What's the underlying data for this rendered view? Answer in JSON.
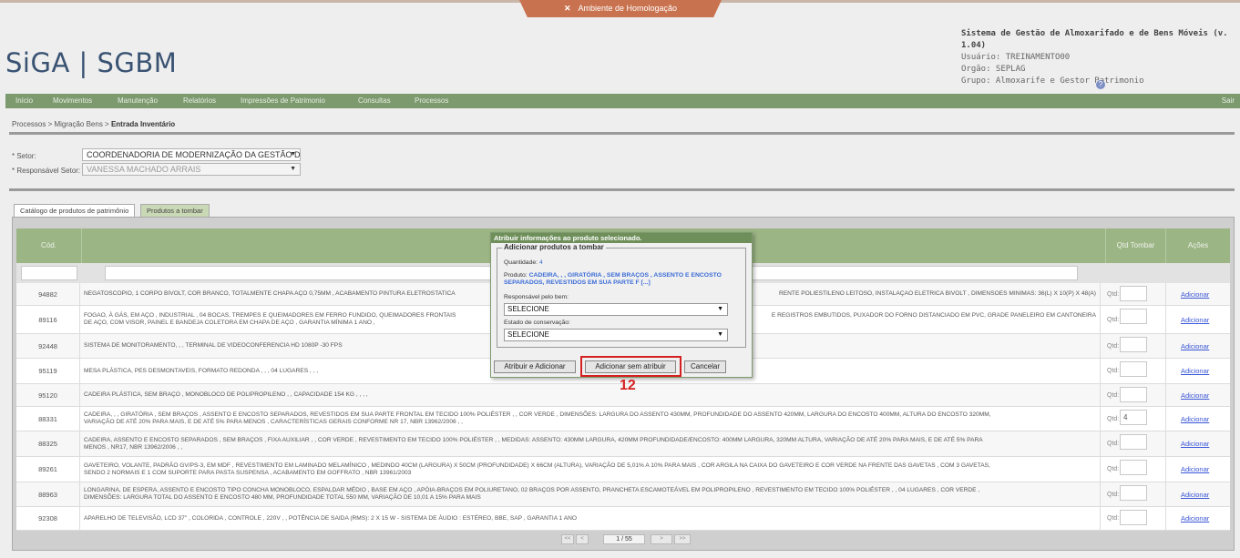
{
  "banner": {
    "label": "Ambiente de Homologação",
    "icon": "tools-icon"
  },
  "header": {
    "logo": "SiGA | SGBM",
    "system_title": "Sistema de Gestão de Almoxarifado e de Bens Móveis (v. 1.04)",
    "usuario": "Usuário: TREINAMENTO00",
    "orgao": "Orgão: SEPLAG",
    "grupo": "Grupo: Almoxarife e Gestor Patrimonio",
    "help_icon": "?"
  },
  "menu": {
    "items": [
      "Início",
      "Movimentos",
      "Manutenção",
      "Relatórios",
      "Impressões de Patrimonio",
      "Consultas",
      "Processos"
    ],
    "sair": "Sair"
  },
  "breadcrumb": {
    "path": "Processos  > Migração Bens  > ",
    "current": "Entrada Inventário"
  },
  "form": {
    "setor_label": "* Setor:",
    "setor_value": "COORDENADORIA DE MODERNIZAÇÃO DA GESTÃO DO",
    "responsavel_label": "* Responsável Setor:",
    "responsavel_value": "VANESSA MACHADO ARRAIS"
  },
  "tabs": [
    "Catálogo de produtos de patrimônio",
    "Produtos a tombar"
  ],
  "table": {
    "headers": {
      "cod": "Cód.",
      "qtd": "Qtd Tombar",
      "acoes": "Ações"
    },
    "qtd_label": "Qtd:",
    "action_label": "Adicionar",
    "rows": [
      {
        "cod": "94882",
        "desc": "NEGATOSCOPIO, 1 CORPO BIVOLT, COR BRANCO, TOTALMENTE CHAPA AÇO 0,75MM , ACABAMENTO PINTURA ELETROSTATICA",
        "desc_right": "RENTE POLIESTILENO LEITOSO, INSTALAÇAO ELETRICA BIVOLT , DIMENSOES MINIMAS: 36(L) X 10(P) X 48(A)",
        "qtd": ""
      },
      {
        "cod": "89116",
        "desc": "FOGAO, À GÁS, EM AÇO , INDUSTRIAL , 04 BOCAS, TREMPES E QUEIMADORES EM FERRO FUNDIDO, QUEIMADORES FRONTAIS",
        "desc2": "DE AÇO, COM VISOR, PAINEL E BANDEJA COLETORA EM CHAPA DE AÇO , GARANTIA MÍNIMA 1 ANO ,",
        "desc_right": "E REGISTROS EMBUTIDOS, PUXADOR DO FORNO DISTANCIADO EM PVC, GRADE PANELEIRO EM CANTONEIRA",
        "qtd": ""
      },
      {
        "cod": "92448",
        "desc": "SISTEMA DE MONITORAMENTO, , , TERMINAL DE VIDEOCONFERENCIA HD 1080P -30 FPS",
        "qtd": ""
      },
      {
        "cod": "95119",
        "desc": "MESA PLÁSTICA, PES DESMONTAVEIS, FORMATO REDONDA , , , 04 LUGARES , , ,",
        "qtd": ""
      },
      {
        "cod": "95120",
        "desc": "CADEIRA PLÁSTICA, SEM BRAÇO , MONOBLOCO DE POLIPROPILENO , , CAPACIDADE 154 KG , , , ,",
        "qtd": ""
      },
      {
        "cod": "88331",
        "desc": "CADEIRA, , , GIRATÓRIA , SEM BRAÇOS , ASSENTO E ENCOSTO SEPARADOS, REVESTIDOS EM SUA PARTE FRONTAL EM TECIDO 100% POLIÉSTER , , COR VERDE , DIMENSÕES: LARGURA DO ASSENTO 430MM, PROFUNDIDADE DO ASSENTO 420MM, LARGURA DO ENCOSTO 400MM, ALTURA DO ENCOSTO 320MM,",
        "desc2": "VARIAÇÃO DE ATÉ 20% PARA MAIS, E DE ATÉ 5% PARA MENOS , CARACTERÍSTICAS GERAIS CONFORME NR 17, NBR 13962/2006 , ,",
        "qtd": "4"
      },
      {
        "cod": "88325",
        "desc": "CADEIRA, ASSENTO E ENCOSTO SEPARADOS , SEM BRAÇOS , FIXA AUXILIAR , , COR VERDE , REVESTIMENTO EM TECIDO 100% POLIÉSTER , , MEDIDAS: ASSENTO: 430MM LARGURA, 420MM PROFUNDIDADE/ENCOSTO: 400MM LARGURA, 320MM ALTURA, VARIAÇÃO DE ATÉ 20% PARA MAIS, E DE ATÉ 5% PARA",
        "desc2": "MENOS , NR17, NBR 13962/2006 , ,",
        "qtd": ""
      },
      {
        "cod": "89261",
        "desc": "GAVETEIRO, VOLANTE, PADRÃO GV/PS-3, EM MDF , REVESTIMENTO EM LAMINADO MELAMÍNICO , MEDINDO 40CM (LARGURA) X 50CM (PROFUNDIDADE) X 66CM (ALTURA), VARIAÇÃO DE 5,01% A 10% PARA MAIS , COR ARGILA NA CAIXA DO GAVETEIRO E COR VERDE NA FRENTE DAS GAVETAS , COM 3 GAVETAS,",
        "desc2": "SENDO 2 NORMAIS E 1 COM SUPORTE PARA PASTA SUSPENSA , ACABAMENTO EM GOFFRATO , NBR 13961/2003",
        "qtd": ""
      },
      {
        "cod": "88963",
        "desc": "LONGARINA, DE ESPERA, ASSENTO E ENCOSTO TIPO CONCHA MONOBLOCO, ESPALDAR MÉDIO , BASE EM AÇO , APÓIA-BRAÇOS EM POLIURETANO, 02 BRAÇOS POR ASSENTO, PRANCHETA ESCAMOTEÁVEL EM POLIPROPILENO , REVESTIMENTO EM TECIDO 100% POLIÉSTER , , 04 LUGARES , COR VERDE ,",
        "desc2": "DIMENSÕES: LARGURA TOTAL DO ASSENTO E ENCOSTO 480 MM, PROFUNDIDADE TOTAL 550 MM, VARIAÇÃO DE 10,01 A 15% PARA MAIS",
        "qtd": ""
      },
      {
        "cod": "92308",
        "desc": "APARELHO DE TELEVISÃO, LCD 37\" , COLORIDA , CONTROLE , 220V , , POTÊNCIA DE SAIDA (RMS): 2 X 15 W - SISTEMA DE ÁUDIO : ESTÉREO, BBE, SAP , GARANTIA 1 ANO",
        "qtd": ""
      }
    ]
  },
  "pager": {
    "first": "<<",
    "prev": "<",
    "info": "1 / 55",
    "next": ">",
    "last": ">>"
  },
  "modal": {
    "title": "Atribuir informações ao produto selecionado.",
    "legend": "Adicionar produtos a tombar",
    "quantidade_label": "Quantidade:",
    "quantidade_value": "4",
    "produto_label": "Produto:",
    "produto_value": "CADEIRA, , , GIRATÓRIA , SEM BRAÇOS , ASSENTO E ENCOSTO SEPARADOS, REVESTIDOS EM SUA PARTE F [...]",
    "responsavel_label": "Responsável pelo bem:",
    "responsavel_value": "SELECIONE",
    "estado_label": "Estado de conservação:",
    "estado_value": "SELECIONE",
    "btn_atribuir": "Atribuir e Adicionar",
    "btn_sem_atribuir": "Adicionar sem atribuir",
    "btn_cancelar": "Cancelar"
  },
  "annotation": {
    "step": "12",
    "color": "#d42020"
  }
}
